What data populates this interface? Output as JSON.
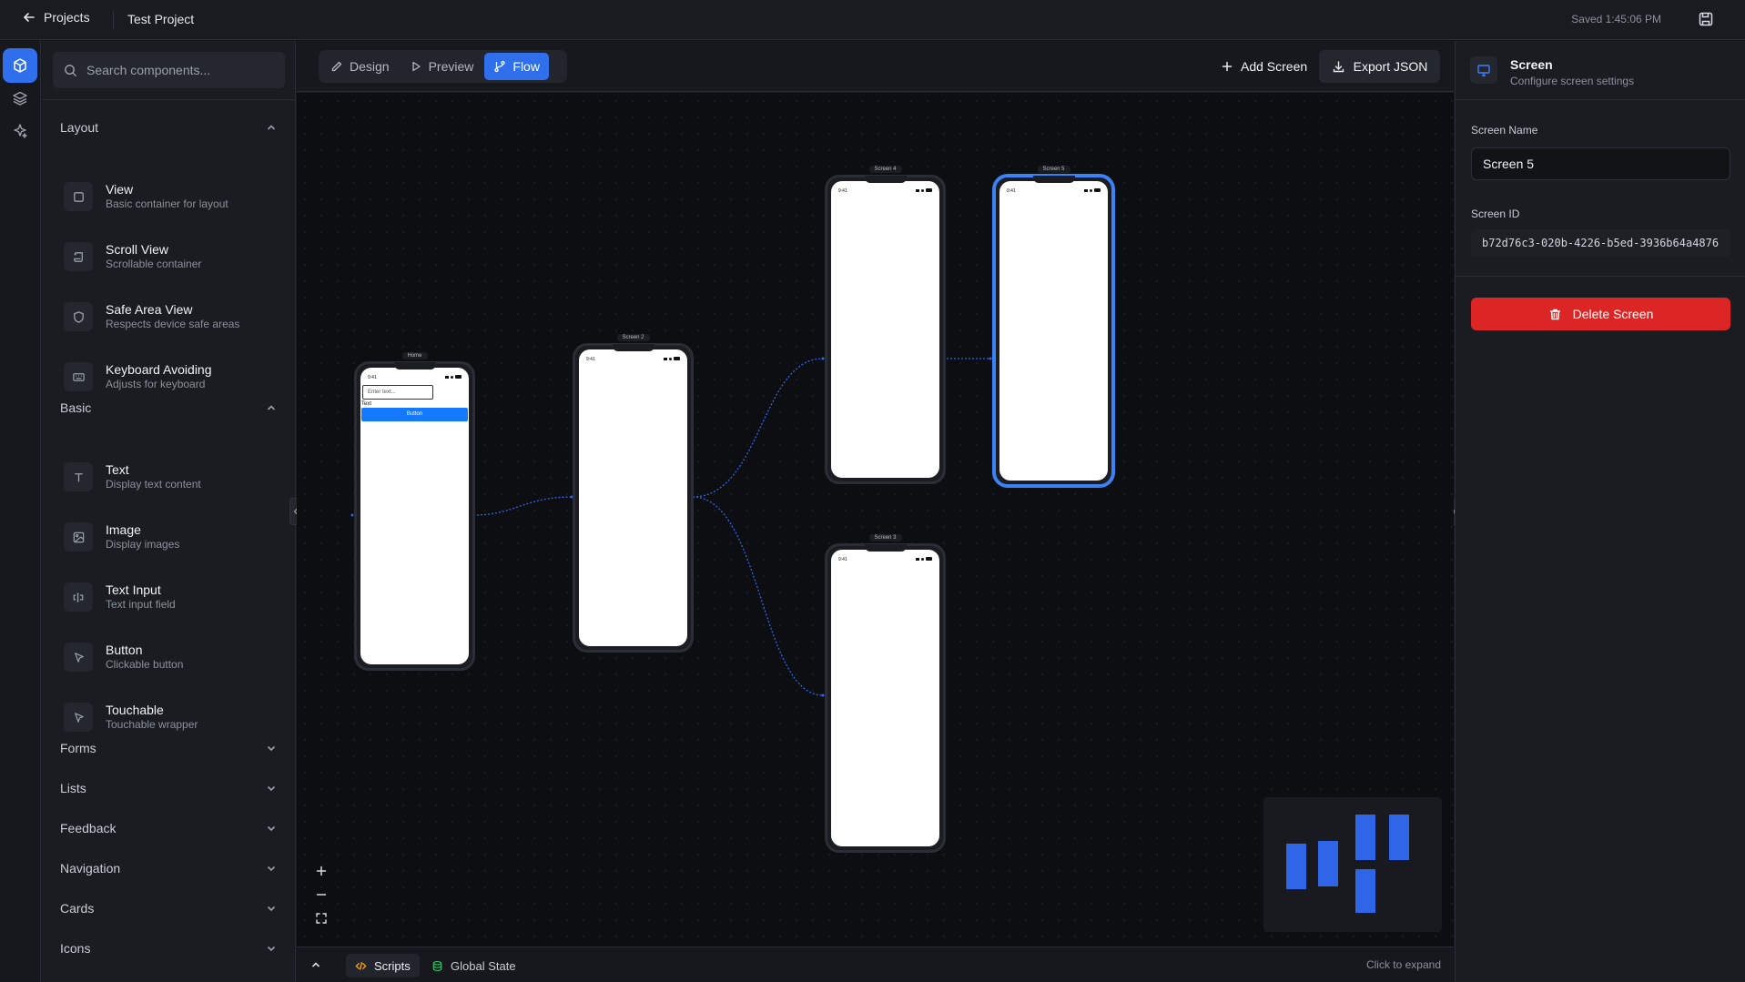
{
  "header": {
    "back_label": "Projects",
    "project_title": "Test Project",
    "saved_status": "Saved 1:45:06 PM"
  },
  "sidebar": {
    "search_placeholder": "Search components...",
    "sections": [
      {
        "label": "Layout",
        "expanded": true
      },
      {
        "label": "Basic",
        "expanded": true
      },
      {
        "label": "Forms",
        "expanded": false
      },
      {
        "label": "Lists",
        "expanded": false
      },
      {
        "label": "Feedback",
        "expanded": false
      },
      {
        "label": "Navigation",
        "expanded": false
      },
      {
        "label": "Cards",
        "expanded": false
      },
      {
        "label": "Icons",
        "expanded": false
      }
    ],
    "layout_items": [
      {
        "name": "View",
        "desc": "Basic container for layout",
        "icon": "square-icon"
      },
      {
        "name": "Scroll View",
        "desc": "Scrollable container",
        "icon": "scroll-icon"
      },
      {
        "name": "Safe Area View",
        "desc": "Respects device safe areas",
        "icon": "shield-icon"
      },
      {
        "name": "Keyboard Avoiding",
        "desc": "Adjusts for keyboard",
        "icon": "keyboard-icon"
      }
    ],
    "basic_items": [
      {
        "name": "Text",
        "desc": "Display text content",
        "icon": "text-icon"
      },
      {
        "name": "Image",
        "desc": "Display images",
        "icon": "image-icon"
      },
      {
        "name": "Text Input",
        "desc": "Text input field",
        "icon": "text-cursor-icon"
      },
      {
        "name": "Button",
        "desc": "Clickable button",
        "icon": "pointer-icon"
      },
      {
        "name": "Touchable",
        "desc": "Touchable wrapper",
        "icon": "pointer-icon"
      }
    ]
  },
  "toolbar": {
    "modes": [
      {
        "label": "Design",
        "icon": "pencil-icon",
        "active": false
      },
      {
        "label": "Preview",
        "icon": "play-icon",
        "active": false
      },
      {
        "label": "Flow",
        "icon": "git-branch-icon",
        "active": true
      }
    ],
    "add_screen_label": "Add Screen",
    "export_label": "Export JSON"
  },
  "canvas": {
    "screens": [
      {
        "label": "Home",
        "time": "9:41",
        "input_placeholder": "Enter text...",
        "text": "Text",
        "button": "Button"
      },
      {
        "label": "Screen 2",
        "time": "9:41"
      },
      {
        "label": "Screen 4",
        "time": "9:41"
      },
      {
        "label": "Screen 5",
        "time": "9:41",
        "selected": true
      },
      {
        "label": "Screen 3",
        "time": "9:41"
      }
    ]
  },
  "bottombar": {
    "tabs": [
      {
        "label": "Scripts",
        "icon": "code-icon",
        "active": true
      },
      {
        "label": "Global State",
        "icon": "database-icon",
        "active": false
      }
    ],
    "hint": "Click to expand"
  },
  "panel": {
    "title": "Screen",
    "subtitle": "Configure screen settings",
    "name_label": "Screen Name",
    "name_value": "Screen 5",
    "id_label": "Screen ID",
    "id_value": "b72d76c3-020b-4226-b5ed-3936b64a4876",
    "delete_label": "Delete Screen"
  },
  "colors": {
    "accent": "#2f6fec",
    "danger": "#dc2626",
    "background": "#0d0e11"
  }
}
